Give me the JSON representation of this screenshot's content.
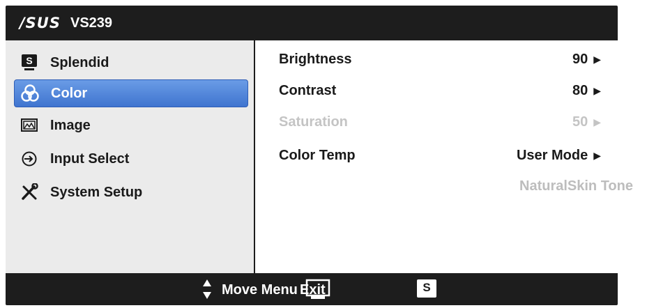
{
  "header": {
    "brand": "/SUS",
    "model": "VS239"
  },
  "menu": [
    {
      "label": "Splendid",
      "icon": "splendid-s-icon",
      "active": false
    },
    {
      "label": "Color",
      "icon": "color-circles-icon",
      "active": true
    },
    {
      "label": "Image",
      "icon": "image-icon",
      "active": false
    },
    {
      "label": "Input Select",
      "icon": "input-select-icon",
      "active": false
    },
    {
      "label": "System Setup",
      "icon": "tools-icon",
      "active": false
    }
  ],
  "settings": [
    {
      "label": "Brightness",
      "value": "90",
      "enabled": true
    },
    {
      "label": "Contrast",
      "value": "80",
      "enabled": true
    },
    {
      "label": "Saturation",
      "value": "50",
      "enabled": false
    },
    {
      "label": "Color Temp",
      "value": "User Mode",
      "enabled": true
    }
  ],
  "extra_option": "NaturalSkin Tone",
  "footer": {
    "move_label": "Move Menu",
    "exit_label": "Exit",
    "s_label": "S"
  },
  "colors": {
    "frame": "#1d1d1d",
    "active_menu": "#4f84da",
    "disabled_text": "#c4c4c4"
  }
}
